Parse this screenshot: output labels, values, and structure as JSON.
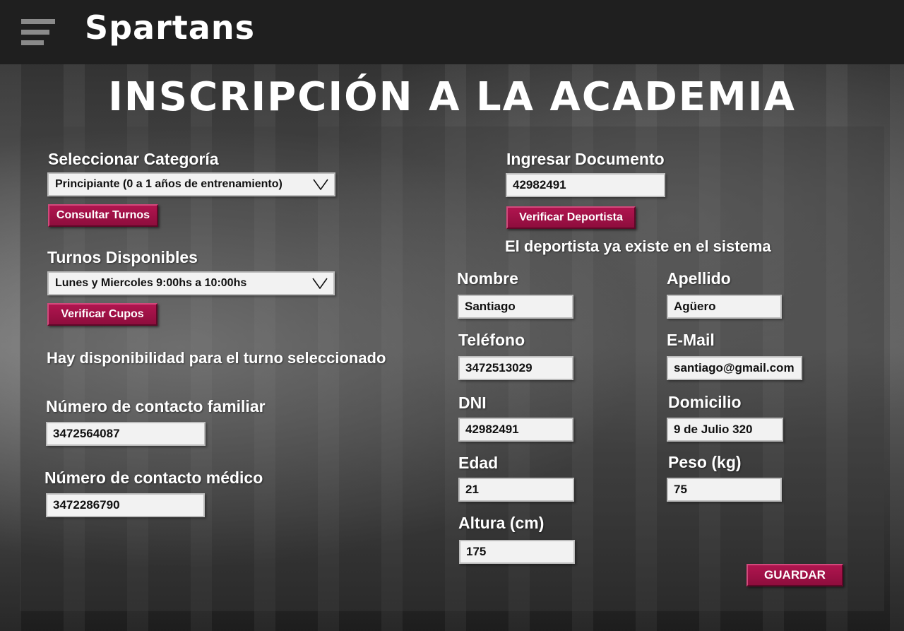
{
  "header": {
    "brand": "Spartans",
    "menu_icon": "hamburger-menu-icon"
  },
  "page": {
    "title": "INSCRIPCIÓN A LA ACADEMIA"
  },
  "left": {
    "categoria_label": "Seleccionar Categoría",
    "categoria_value": "Principiante (0 a 1 años de entrenamiento)",
    "consultar_turnos_button": "Consultar Turnos",
    "turnos_label": "Turnos Disponibles",
    "turnos_value": "Lunes y Miercoles 9:00hs a 10:00hs",
    "verificar_cupos_button": "Verificar Cupos",
    "disponibilidad_message": "Hay disponibilidad para el turno seleccionado",
    "contacto_familiar_label": "Número de contacto familiar",
    "contacto_familiar_value": "3472564087",
    "contacto_medico_label": "Número de contacto médico",
    "contacto_medico_value": "3472286790"
  },
  "right": {
    "documento_label": "Ingresar Documento",
    "documento_value": "42982491",
    "verificar_deportista_button": "Verificar Deportista",
    "existe_message": "El deportista ya existe en el sistema",
    "nombre_label": "Nombre",
    "nombre_value": "Santiago",
    "apellido_label": "Apellido",
    "apellido_value": "Agüero",
    "telefono_label": "Teléfono",
    "telefono_value": "3472513029",
    "email_label": "E-Mail",
    "email_value": "santiago@gmail.com",
    "dni_label": "DNI",
    "dni_value": "42982491",
    "domicilio_label": "Domicilio",
    "domicilio_value": "9 de Julio 320",
    "edad_label": "Edad",
    "edad_value": "21",
    "peso_label": "Peso (kg)",
    "peso_value": "75",
    "altura_label": "Altura (cm)",
    "altura_value": "175",
    "guardar_button": "GUARDAR"
  },
  "colors": {
    "accent": "#9e1046",
    "topbar": "#1f1f1f",
    "field_bg": "#f2f2f2"
  }
}
